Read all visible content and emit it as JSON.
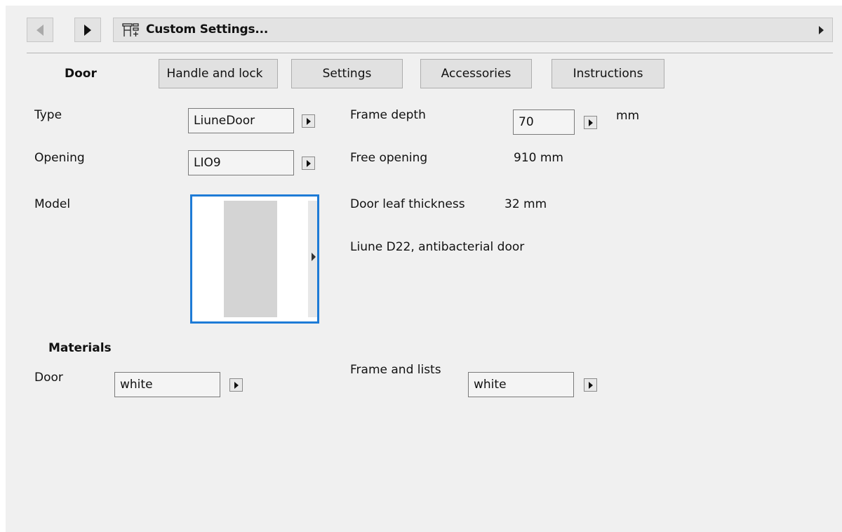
{
  "header": {
    "title": "Custom Settings...",
    "icons": [
      "back-arrow-icon",
      "forward-arrow-icon",
      "custom-settings-icon",
      "expand-arrow-icon"
    ]
  },
  "tabs": {
    "active": "Door",
    "items": [
      "Handle and lock",
      "Settings",
      "Accessories",
      "Instructions"
    ]
  },
  "door": {
    "type_label": "Type",
    "type_value": "LiuneDoor",
    "opening_label": "Opening",
    "opening_value": "LIO9",
    "model_label": "Model",
    "frame_depth_label": "Frame depth",
    "frame_depth_value": "70",
    "frame_depth_unit": "mm",
    "free_opening_label": "Free opening",
    "free_opening_value": "910 mm",
    "leaf_thickness_label": "Door leaf thickness",
    "leaf_thickness_value": "32 mm",
    "description": "Liune D22, antibacterial door"
  },
  "materials": {
    "heading": "Materials",
    "door_label": "Door",
    "door_value": "white",
    "frame_label": "Frame and lists",
    "frame_value": "white"
  },
  "colors": {
    "panel_bg": "#f0f0f0",
    "accent": "#1e7bd6",
    "button_bg": "#e1e1e1"
  }
}
